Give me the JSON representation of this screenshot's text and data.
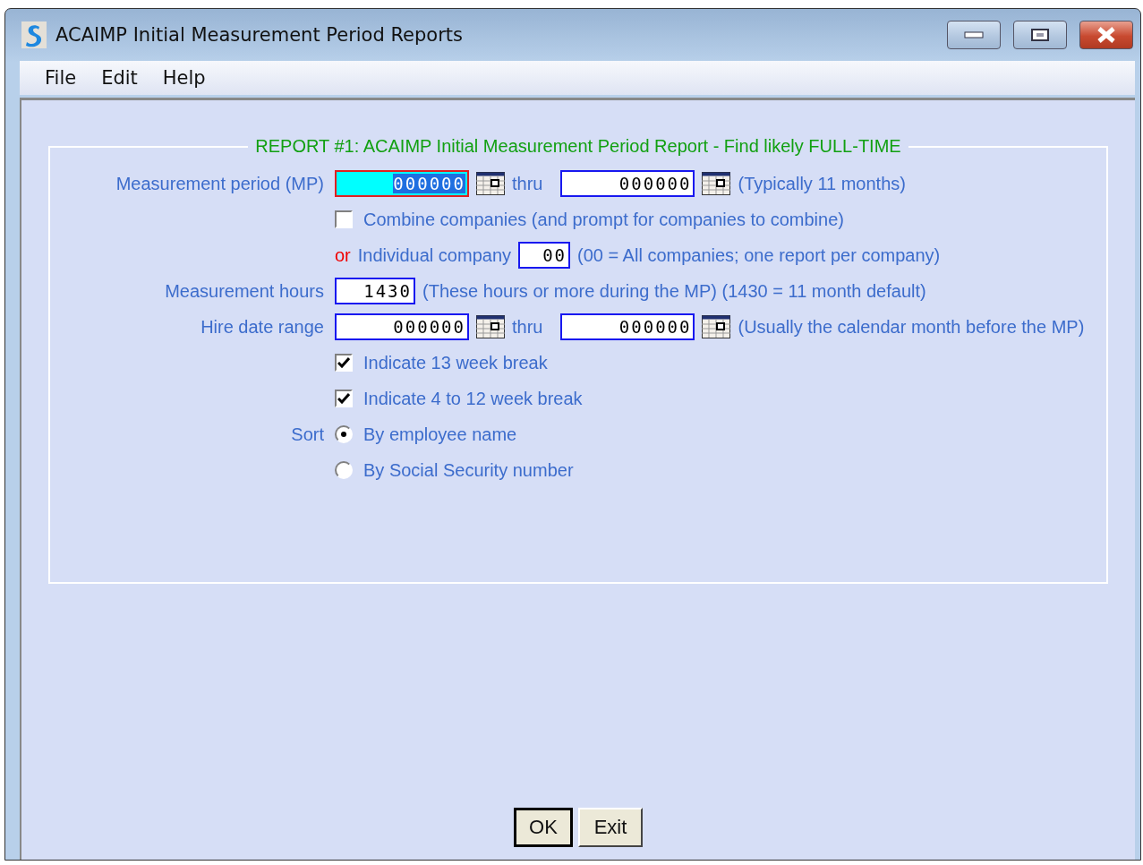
{
  "window": {
    "title": "ACAIMP Initial Measurement Period Reports"
  },
  "menu": [
    {
      "label": "File"
    },
    {
      "label": "Edit"
    },
    {
      "label": "Help"
    }
  ],
  "report": {
    "title": "REPORT #1: ACAIMP Initial Measurement Period Report - Find likely FULL-TIME",
    "measurement_period": {
      "label": "Measurement period (MP)",
      "from": {
        "value": "000000",
        "focused": true
      },
      "thru_label": "thru",
      "to": {
        "value": "000000",
        "focused": false
      },
      "note": "(Typically 11 months)"
    },
    "combine": {
      "label": "Combine companies (and prompt for companies to combine)",
      "checked": false
    },
    "individual": {
      "or_label": "or",
      "label": "Individual company",
      "value": "00",
      "note": "(00 = All companies; one report per company)"
    },
    "hours": {
      "label": "Measurement hours",
      "value": "1430",
      "note": "(These hours or more during the MP) (1430 = 11 month default)"
    },
    "hire_date": {
      "label": "Hire date range",
      "from": {
        "value": "000000",
        "focused": false
      },
      "thru_label": "thru",
      "to": {
        "value": "000000",
        "focused": false
      },
      "note": "(Usually the calendar month before the MP)"
    },
    "checks": [
      {
        "label": "Indicate 13 week break",
        "checked": true
      },
      {
        "label": "Indicate 4 to 12 week break",
        "checked": true
      }
    ],
    "sort": {
      "label": "Sort",
      "options": [
        {
          "label": "By employee name",
          "selected": true
        },
        {
          "label": "By Social Security number",
          "selected": false
        }
      ]
    }
  },
  "buttons": [
    {
      "label": "OK",
      "default": true
    },
    {
      "label": "Exit",
      "default": false
    }
  ]
}
